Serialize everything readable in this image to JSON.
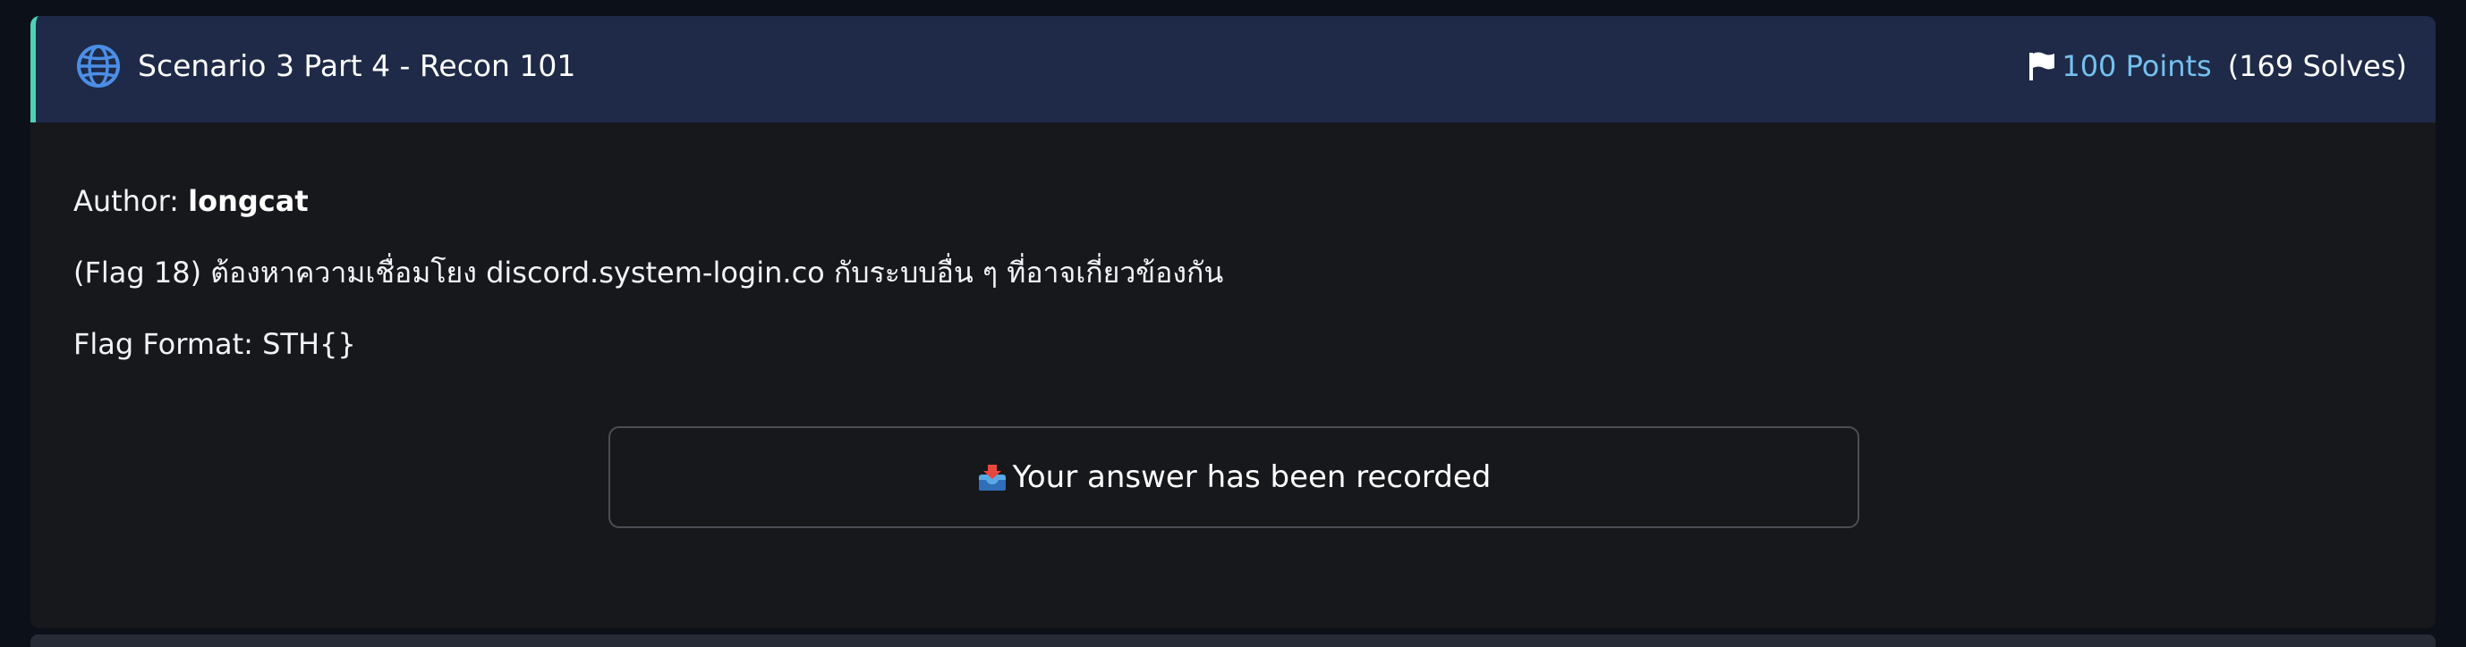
{
  "challenge": {
    "icon": "globe-icon",
    "title": "Scenario 3 Part 4 - Recon 101",
    "points_icon": "flag-icon",
    "points": "100 Points",
    "solves": "(169 Solves)"
  },
  "description": {
    "author_label": "Author:",
    "author_name": "longcat",
    "text": "(Flag 18) ต้องหาความเชื่อมโยง discord.system-login.co กับระบบอื่น ๆ ที่อาจเกี่ยวข้องกัน",
    "flag_format": "Flag Format: STH{}"
  },
  "answer": {
    "icon": "inbox-tray-icon",
    "status": "Your answer has been recorded"
  },
  "colors": {
    "header_bg": "#1e2a47",
    "accent_border": "#4fd1b5",
    "points": "#74c0f0",
    "body_bg": "#17181c",
    "page_bg": "#0c1018"
  }
}
